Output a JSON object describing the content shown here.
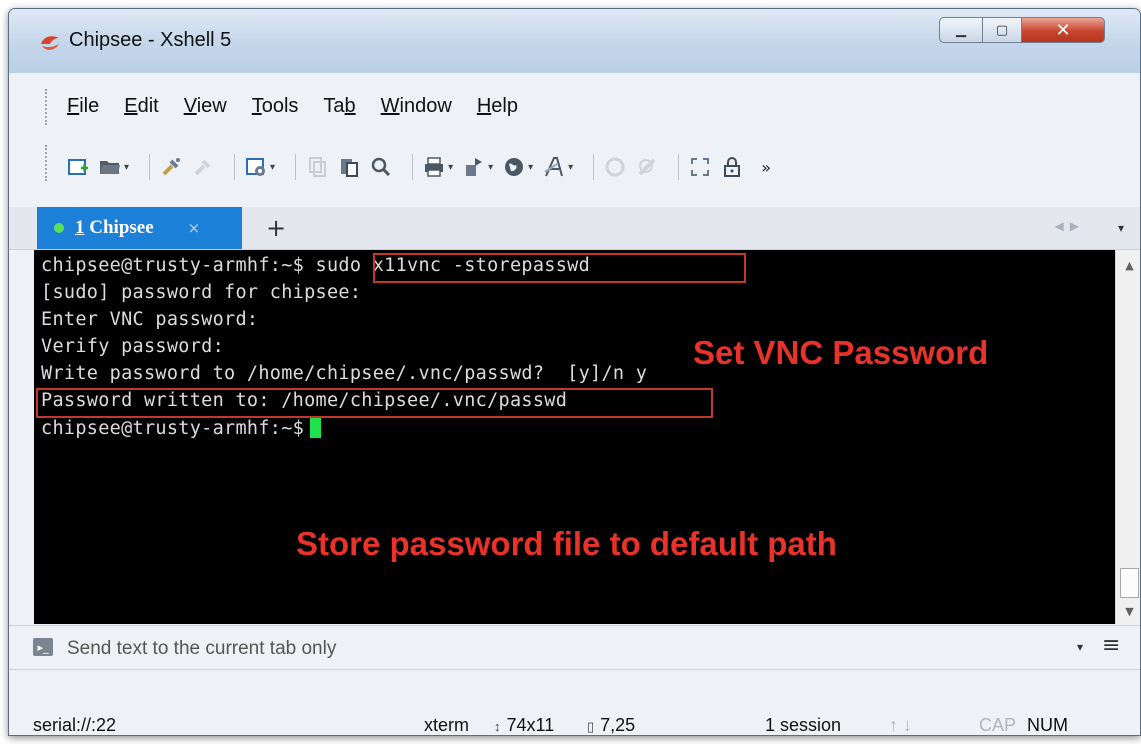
{
  "window": {
    "title": "Chipsee - Xshell 5",
    "buttons": {
      "minimize": "▁",
      "maximize": "▢",
      "close": "✕"
    }
  },
  "menu": [
    {
      "label": "File",
      "access": "F",
      "rest": "ile"
    },
    {
      "label": "Edit",
      "access": "E",
      "rest": "dit"
    },
    {
      "label": "View",
      "access": "V",
      "rest": "iew"
    },
    {
      "label": "Tools",
      "access": "T",
      "rest": "ools"
    },
    {
      "label": "Tab",
      "pre": "Ta",
      "access": "b",
      "rest": ""
    },
    {
      "label": "Window",
      "access": "W",
      "rest": "indow"
    },
    {
      "label": "Help",
      "access": "H",
      "rest": "elp"
    }
  ],
  "toolbar": {
    "icons": [
      "new-session-icon",
      "open-folder-icon",
      "connect-icon",
      "disconnect-icon",
      "properties-icon",
      "copy-icon",
      "paste-icon",
      "find-icon",
      "print-icon",
      "transfer-icon",
      "globe-icon",
      "font-icon",
      "script-icon",
      "xftp-icon",
      "fullscreen-icon",
      "lock-icon",
      "more-icon"
    ],
    "overflow": "»"
  },
  "tabs": [
    {
      "number": "1",
      "name": "Chipsee",
      "label": "1 Chipsee",
      "close": "×",
      "active": true,
      "status_color": "#5ce05a"
    }
  ],
  "tab_add": "+",
  "terminal": {
    "lines": [
      {
        "prompt": "chipsee@trusty-armhf:~$",
        "command": " sudo x11vnc -storepasswd"
      },
      {
        "text": "[sudo] password for chipsee:"
      },
      {
        "text": "Enter VNC password:"
      },
      {
        "text": "Verify password:"
      },
      {
        "text": "Write password to /home/chipsee/.vnc/passwd?  [y]/n y"
      },
      {
        "text": "Password written to: /home/chipsee/.vnc/passwd"
      },
      {
        "prompt": "chipsee@trusty-armhf:~$",
        "command": ""
      }
    ],
    "annotations": [
      {
        "text": "Set VNC Password",
        "color": "#e8322a"
      },
      {
        "text": "Store password file to default path",
        "color": "#e8322a"
      }
    ],
    "cursor_color": "#1ee44c"
  },
  "send_bar": {
    "placeholder": "Send text to the current tab only"
  },
  "status": {
    "connection": "serial://:22",
    "terminal_type": "xterm",
    "size": "74x11",
    "cursor_pos": "7,25",
    "sessions": "1 session",
    "cap": "CAP",
    "num": "NUM"
  }
}
